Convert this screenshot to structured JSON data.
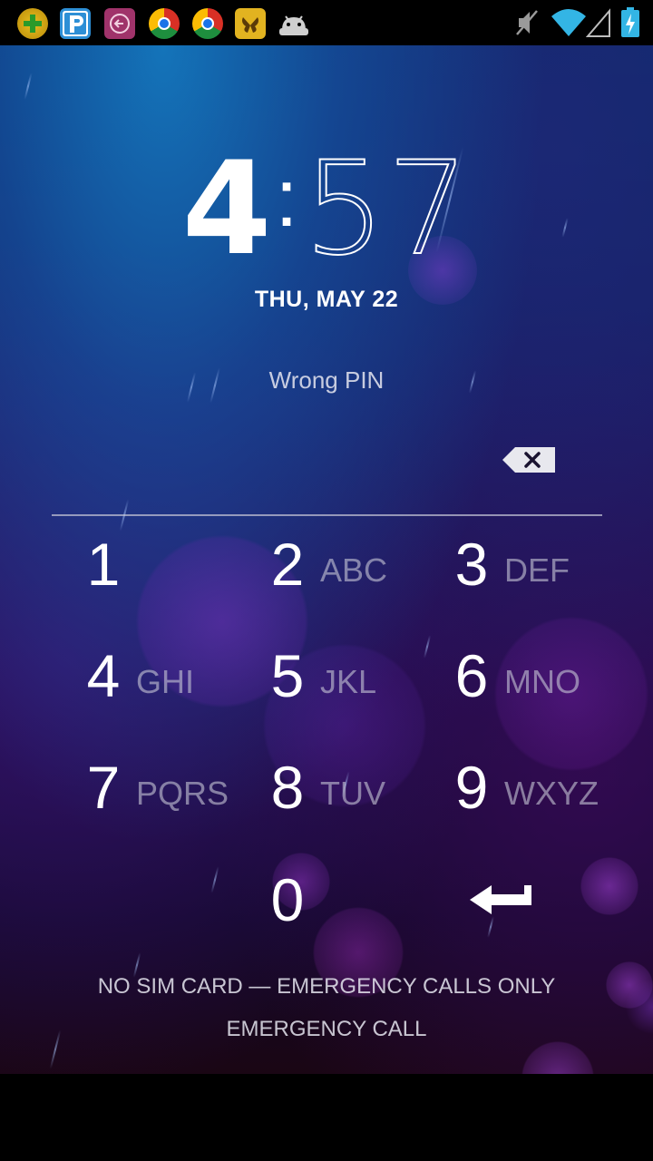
{
  "status_bar": {
    "notification_icons": [
      "add-app-icon",
      "parking-app-icon",
      "back-circle-app-icon",
      "chrome-app-icon",
      "chrome-app-icon-2",
      "butterfly-app-icon",
      "android-icon"
    ],
    "system_icons": [
      "muted-icon",
      "wifi-icon",
      "signal-icon",
      "battery-charging-icon"
    ]
  },
  "lockscreen": {
    "clock_hour": "4",
    "clock_separator": ":",
    "clock_minute": "57",
    "date": "THU, MAY 22",
    "message": "Wrong PIN",
    "backspace_icon": "backspace-icon"
  },
  "keypad": {
    "keys": [
      {
        "digit": "1",
        "letters": ""
      },
      {
        "digit": "2",
        "letters": "ABC"
      },
      {
        "digit": "3",
        "letters": "DEF"
      },
      {
        "digit": "4",
        "letters": "GHI"
      },
      {
        "digit": "5",
        "letters": "JKL"
      },
      {
        "digit": "6",
        "letters": "MNO"
      },
      {
        "digit": "7",
        "letters": "PQRS"
      },
      {
        "digit": "8",
        "letters": "TUV"
      },
      {
        "digit": "9",
        "letters": "WXYZ"
      },
      {
        "digit": "0",
        "letters": ""
      }
    ],
    "enter_icon": "enter-arrow-icon"
  },
  "footer": {
    "carrier_text": "NO SIM CARD — EMERGENCY CALLS ONLY",
    "emergency_call_label": "EMERGENCY CALL"
  },
  "colors": {
    "text": "#ffffff",
    "muted_letters": "#c8c8d7",
    "divider": "#c8c8d7"
  }
}
